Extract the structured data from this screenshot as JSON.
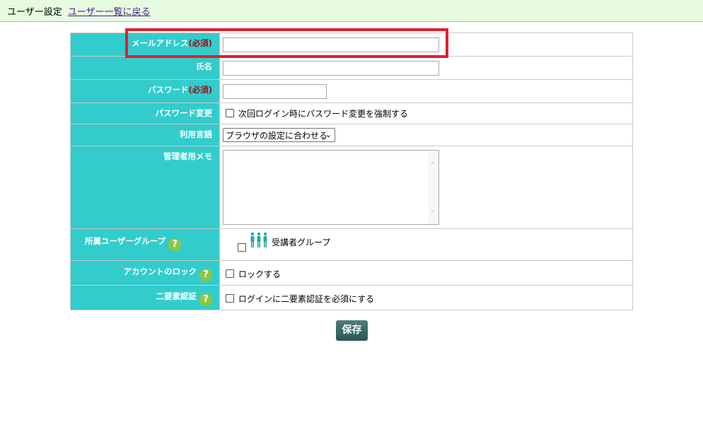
{
  "header": {
    "title": "ユーザー設定",
    "back_link": "ユーザー一覧に戻る"
  },
  "form": {
    "email": {
      "label": "メールアドレス",
      "required": "(必須)",
      "value": ""
    },
    "name": {
      "label": "氏名",
      "value": ""
    },
    "password": {
      "label": "パスワード",
      "required": "(必須)",
      "value": ""
    },
    "password_change": {
      "label": "パスワード変更",
      "checkbox_label": "次回ログイン時にパスワード変更を強制する",
      "checked": false
    },
    "language": {
      "label": "利用言語",
      "selected": "ブラウザの設定に合わせる"
    },
    "admin_memo": {
      "label": "管理者用メモ",
      "value": ""
    },
    "user_group": {
      "label": "所属ユーザーグループ",
      "help": "?",
      "group_name": "受講者グループ",
      "checked": false
    },
    "account_lock": {
      "label": "アカウントのロック",
      "help": "?",
      "checkbox_label": "ロックする",
      "checked": false
    },
    "two_factor": {
      "label": "二要素認証",
      "help": "?",
      "checkbox_label": "ログインに二要素認証を必須にする",
      "checked": false
    }
  },
  "actions": {
    "save_label": "保存"
  },
  "colors": {
    "label_bg": "#33cccc",
    "header_bg": "#e6fbe0",
    "highlight": "#e0202e",
    "help_icon": "#8dc63f",
    "save_button": "#2f5f5d"
  }
}
